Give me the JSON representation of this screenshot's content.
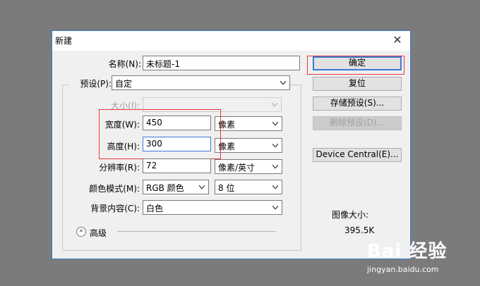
{
  "window": {
    "title": "新建"
  },
  "form": {
    "name_label": "名称(N):",
    "name_value": "未标题-1",
    "preset_label": "预设(P):",
    "preset_value": "自定",
    "size_label": "大小(I):",
    "size_value": "",
    "width_label": "宽度(W):",
    "width_value": "450",
    "width_unit": "像素",
    "height_label": "高度(H):",
    "height_value": "300",
    "height_unit": "像素",
    "resolution_label": "分辨率(R):",
    "resolution_value": "72",
    "resolution_unit": "像素/英寸",
    "color_mode_label": "颜色模式(M):",
    "color_mode_value": "RGB 颜色",
    "bit_depth_value": "8 位",
    "background_label": "背景内容(C):",
    "background_value": "白色",
    "advanced_label": "高级"
  },
  "buttons": {
    "ok": "确定",
    "reset": "复位",
    "save_preset": "存储预设(S)...",
    "delete_preset": "删除预设(D)...",
    "device_central": "Device Central(E)..."
  },
  "image_size": {
    "label": "图像大小:",
    "value": "395.5K"
  },
  "watermark": {
    "logo": "Bai 经验",
    "url": "jingyan.baidu.com"
  }
}
